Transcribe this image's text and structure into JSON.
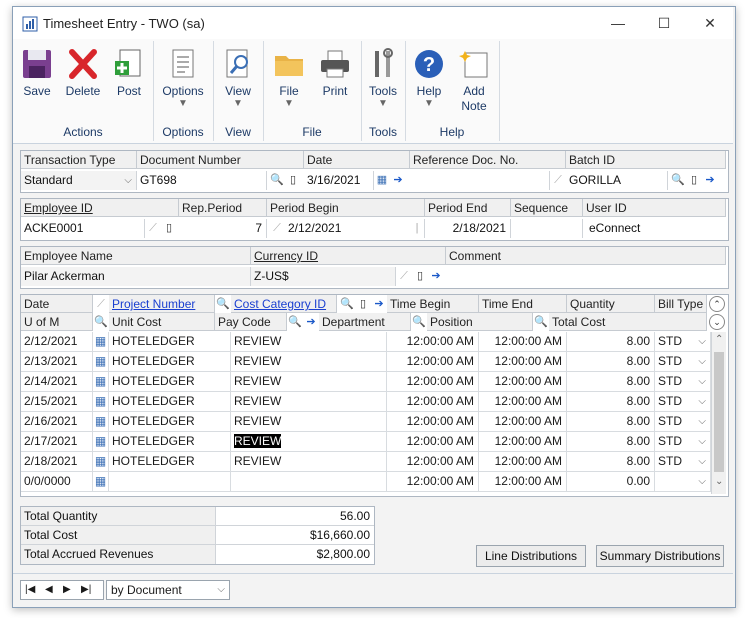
{
  "window": {
    "title": "Timesheet Entry  -  TWO (sa)",
    "minimize": "—",
    "maximize": "☐",
    "close": "✕"
  },
  "ribbon": {
    "groups": [
      {
        "label": "Actions",
        "buttons": [
          {
            "label": "Save"
          },
          {
            "label": "Delete"
          },
          {
            "label": "Post"
          }
        ]
      },
      {
        "label": "Options",
        "buttons": [
          {
            "label": "Options"
          }
        ]
      },
      {
        "label": "View",
        "buttons": [
          {
            "label": "View"
          }
        ]
      },
      {
        "label": "File",
        "buttons": [
          {
            "label": "File"
          },
          {
            "label": "Print"
          }
        ]
      },
      {
        "label": "Tools",
        "buttons": [
          {
            "label": "Tools"
          }
        ]
      },
      {
        "label": "Help",
        "buttons": [
          {
            "label": "Help"
          },
          {
            "label": "Add\nNote"
          }
        ]
      }
    ]
  },
  "header": {
    "transaction_type_label": "Transaction Type",
    "transaction_type": "Standard",
    "document_number_label": "Document Number",
    "document_number": "GT698",
    "date_label": "Date",
    "date": "3/16/2021",
    "reference_doc_label": "Reference Doc. No.",
    "reference_doc": "",
    "batch_id_label": "Batch ID",
    "batch_id": "GORILLA",
    "employee_id_label": "Employee ID",
    "employee_id": "ACKE0001",
    "rep_period_label": "Rep.Period",
    "rep_period": "7",
    "period_begin_label": "Period Begin",
    "period_begin": "2/12/2021",
    "period_end_label": "Period End",
    "period_end": "2/18/2021",
    "sequence_label": "Sequence",
    "sequence": "",
    "user_id_label": "User ID",
    "user_id": "eConnect",
    "employee_name_label": "Employee Name",
    "employee_name": "Pilar Ackerman",
    "currency_id_label": "Currency ID",
    "currency_id": "Z-US$",
    "comment_label": "Comment",
    "comment": ""
  },
  "grid": {
    "headers1": {
      "date": "Date",
      "project": "Project Number",
      "cost_category": "Cost Category ID",
      "time_begin": "Time Begin",
      "time_end": "Time End",
      "quantity": "Quantity",
      "bill_type": "Bill Type"
    },
    "headers2": {
      "uofm": "U of M",
      "unit_cost": "Unit Cost",
      "pay_code": "Pay Code",
      "department": "Department",
      "position": "Position",
      "total_cost": "Total Cost"
    },
    "rows": [
      {
        "date": "2/12/2021",
        "project": "HOTELEDGER",
        "category": "REVIEW",
        "begin": "12:00:00 AM",
        "end": "12:00:00 AM",
        "qty": "8.00",
        "bill": "STD"
      },
      {
        "date": "2/13/2021",
        "project": "HOTELEDGER",
        "category": "REVIEW",
        "begin": "12:00:00 AM",
        "end": "12:00:00 AM",
        "qty": "8.00",
        "bill": "STD"
      },
      {
        "date": "2/14/2021",
        "project": "HOTELEDGER",
        "category": "REVIEW",
        "begin": "12:00:00 AM",
        "end": "12:00:00 AM",
        "qty": "8.00",
        "bill": "STD"
      },
      {
        "date": "2/15/2021",
        "project": "HOTELEDGER",
        "category": "REVIEW",
        "begin": "12:00:00 AM",
        "end": "12:00:00 AM",
        "qty": "8.00",
        "bill": "STD"
      },
      {
        "date": "2/16/2021",
        "project": "HOTELEDGER",
        "category": "REVIEW",
        "begin": "12:00:00 AM",
        "end": "12:00:00 AM",
        "qty": "8.00",
        "bill": "STD"
      },
      {
        "date": "2/17/2021",
        "project": "HOTELEDGER",
        "category": "REVIEW",
        "begin": "12:00:00 AM",
        "end": "12:00:00 AM",
        "qty": "8.00",
        "bill": "STD"
      },
      {
        "date": "2/18/2021",
        "project": "HOTELEDGER",
        "category": "REVIEW",
        "begin": "12:00:00 AM",
        "end": "12:00:00 AM",
        "qty": "8.00",
        "bill": "STD"
      },
      {
        "date": "0/0/0000",
        "project": "",
        "category": "",
        "begin": "12:00:00 AM",
        "end": "12:00:00 AM",
        "qty": "0.00",
        "bill": ""
      }
    ]
  },
  "totals": {
    "total_quantity_label": "Total Quantity",
    "total_quantity": "56.00",
    "total_cost_label": "Total Cost",
    "total_cost": "$16,660.00",
    "total_accrued_label": "Total Accrued Revenues",
    "total_accrued": "$2,800.00"
  },
  "buttons": {
    "line_distributions": "Line Distributions",
    "summary_distributions": "Summary Distributions"
  },
  "footer": {
    "sort_by": "by Document"
  },
  "colors": {
    "link": "#1a3fd0",
    "selection": "#000000",
    "ribbon_text": "#1d3a66"
  }
}
